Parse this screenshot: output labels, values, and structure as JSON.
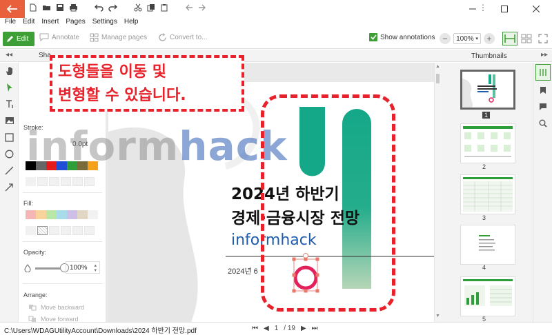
{
  "titlebar": {
    "back_icon": "back-arrow-icon",
    "icons": [
      "new-page-icon",
      "open-folder-icon",
      "save-icon",
      "print-icon",
      "undo-icon",
      "redo-icon",
      "cut-icon",
      "copy-icon",
      "paste-icon",
      "page-back-icon",
      "page-forward-icon"
    ]
  },
  "menu": {
    "items": [
      "File",
      "Edit",
      "Insert",
      "Pages",
      "Settings",
      "Help"
    ]
  },
  "toolbar": {
    "edit_label": "Edit",
    "annotate_label": "Annotate",
    "manage_pages_label": "Manage pages",
    "convert_label": "Convert to...",
    "show_annotations_label": "Show annotations",
    "zoom_value": "100%",
    "accent_color": "#3f9f37"
  },
  "tabs": {
    "shape_tab": "Sha",
    "thumbnails_title": "Thumbnails"
  },
  "properties": {
    "stroke_label": "Stroke:",
    "stroke_value": "0.0pt",
    "fill_label": "Fill:",
    "opacity_label": "Opacity:",
    "opacity_value": "100%",
    "arrange_label": "Arrange:",
    "move_backward_label": "Move backward",
    "move_forward_label": "Move forward",
    "opacity_level_percent": 100
  },
  "page": {
    "title_line1": "2024년 하반기",
    "title_line2": "경제·금융시장 전망",
    "brand": "informhack",
    "date": "2024년 6"
  },
  "callout": {
    "line1": "도형들을 이동 및",
    "line2": "변형할 수 있습니다."
  },
  "watermark": {
    "part1": "inform",
    "part2": "hack"
  },
  "thumbnails": [
    {
      "number": "1"
    },
    {
      "number": "2"
    },
    {
      "number": "3"
    },
    {
      "number": "4"
    },
    {
      "number": "5"
    }
  ],
  "status": {
    "path": "C:\\Users\\WDAGUtilityAccount\\Downloads\\2024 하반기 전망.pdf",
    "current_page": "1",
    "total_pages": "/ 19"
  }
}
